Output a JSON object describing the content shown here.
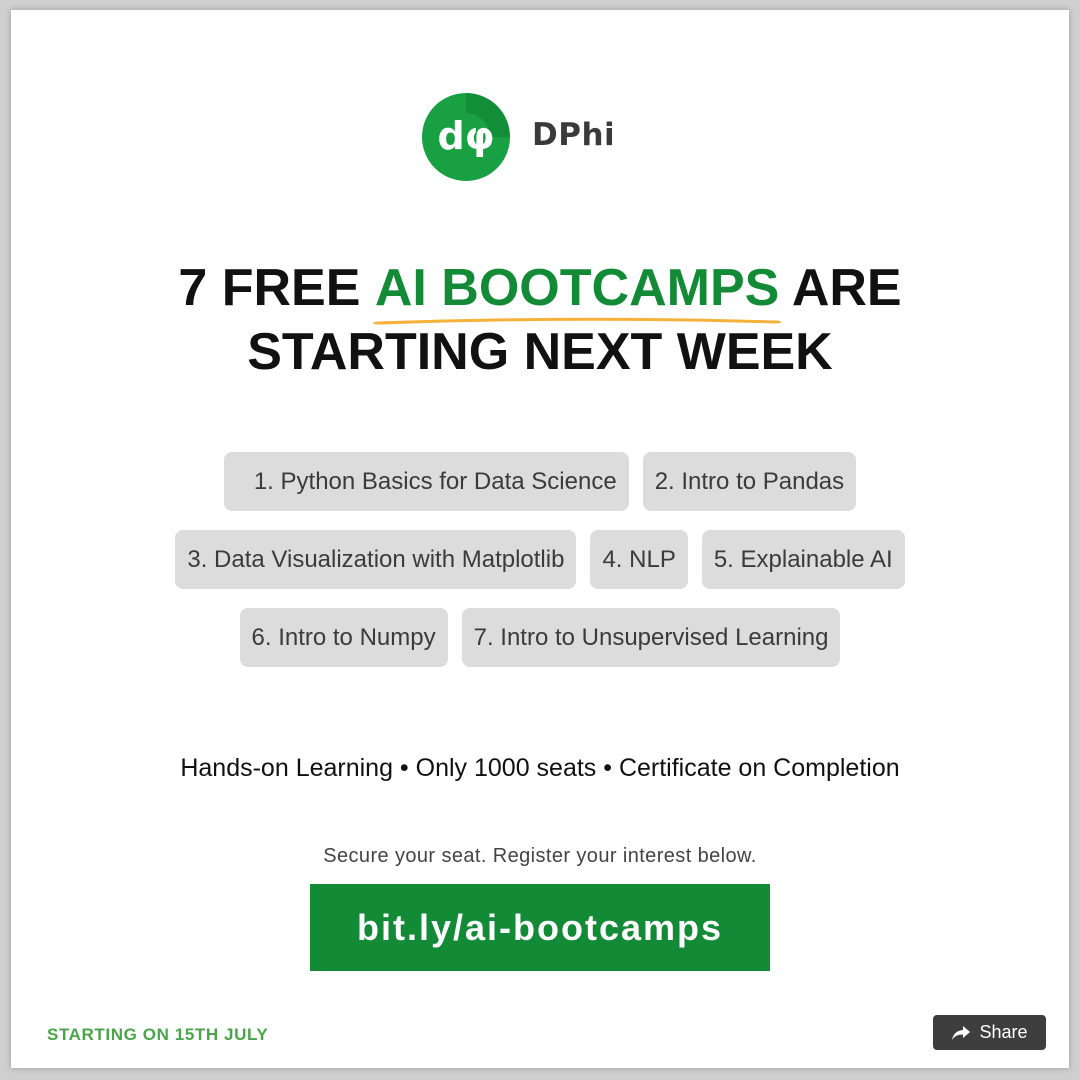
{
  "brand": {
    "name": "DPhi",
    "logo_glyph": "dφ",
    "color": "#138a36"
  },
  "headline": {
    "part1": "7 FREE ",
    "highlight": "AI BOOTCAMPS",
    "part2": " ARE",
    "line2": "STARTING NEXT WEEK",
    "highlight_color": "#138a36",
    "underline_color": "#f5b13a"
  },
  "bootcamps": [
    "1. Python Basics for Data Science",
    "2. Intro to Pandas",
    "3. Data Visualization with Matplotlib",
    "4. NLP",
    "5. Explainable AI",
    "6. Intro to Numpy",
    "7. Intro to Unsupervised Learning"
  ],
  "features": "Hands-on Learning • Only 1000 seats • Certificate on Completion",
  "subtext": "Secure your seat. Register your interest below.",
  "cta": {
    "label": "bit.ly/ai-bootcamps",
    "color": "#138a36"
  },
  "start_date": "STARTING ON 15TH JULY",
  "share": {
    "label": "Share",
    "icon": "share-arrow-icon"
  }
}
